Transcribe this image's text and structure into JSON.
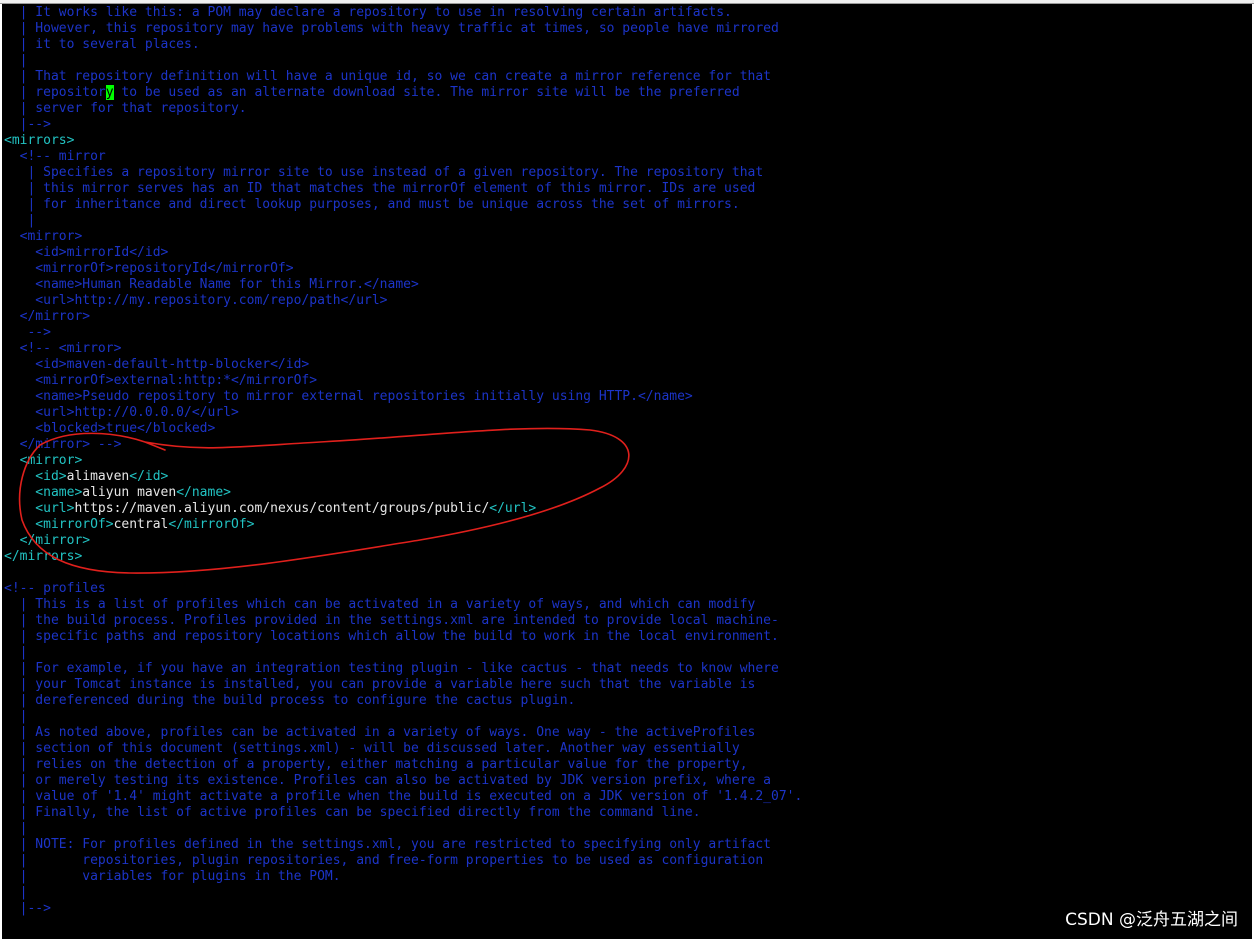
{
  "editor": {
    "lines": [
      {
        "segments": [
          {
            "t": "  | It works like this: a POM may declare a repository to use in resolving certain artifacts.",
            "c": "comment"
          }
        ]
      },
      {
        "segments": [
          {
            "t": "  | However, this repository may have problems with heavy traffic at times, so people have mirrored",
            "c": "comment"
          }
        ]
      },
      {
        "segments": [
          {
            "t": "  | it to several places.",
            "c": "comment"
          }
        ]
      },
      {
        "segments": [
          {
            "t": "  |",
            "c": "comment"
          }
        ]
      },
      {
        "segments": [
          {
            "t": "  | That repository definition will have a unique id, so we can create a mirror reference for that",
            "c": "comment"
          }
        ]
      },
      {
        "segments": [
          {
            "t": "  | repositor",
            "c": "comment"
          },
          {
            "t": "y",
            "c": "cursor"
          },
          {
            "t": " to be used as an alternate download site. The mirror site will be the preferred",
            "c": "comment"
          }
        ]
      },
      {
        "segments": [
          {
            "t": "  | server for that repository.",
            "c": "comment"
          }
        ]
      },
      {
        "segments": [
          {
            "t": "  |-->",
            "c": "comment"
          }
        ]
      },
      {
        "segments": [
          {
            "t": "<mirrors>",
            "c": "tag"
          }
        ]
      },
      {
        "segments": [
          {
            "t": "  <!-- mirror",
            "c": "comment"
          }
        ]
      },
      {
        "segments": [
          {
            "t": "   | Specifies a repository mirror site to use instead of a given repository. The repository that",
            "c": "comment"
          }
        ]
      },
      {
        "segments": [
          {
            "t": "   | this mirror serves has an ID that matches the mirrorOf element of this mirror. IDs are used",
            "c": "comment"
          }
        ]
      },
      {
        "segments": [
          {
            "t": "   | for inheritance and direct lookup purposes, and must be unique across the set of mirrors.",
            "c": "comment"
          }
        ]
      },
      {
        "segments": [
          {
            "t": "   |",
            "c": "comment"
          }
        ]
      },
      {
        "segments": [
          {
            "t": "  <mirror>",
            "c": "comment"
          }
        ]
      },
      {
        "segments": [
          {
            "t": "    <id>mirrorId</id>",
            "c": "comment"
          }
        ]
      },
      {
        "segments": [
          {
            "t": "    <mirrorOf>repositoryId</mirrorOf>",
            "c": "comment"
          }
        ]
      },
      {
        "segments": [
          {
            "t": "    <name>Human Readable Name for this Mirror.</name>",
            "c": "comment"
          }
        ]
      },
      {
        "segments": [
          {
            "t": "    <url>http://my.repository.com/repo/path</url>",
            "c": "comment"
          }
        ]
      },
      {
        "segments": [
          {
            "t": "  </mirror>",
            "c": "comment"
          }
        ]
      },
      {
        "segments": [
          {
            "t": "   -->",
            "c": "comment"
          }
        ]
      },
      {
        "segments": [
          {
            "t": "  <!-- <mirror>",
            "c": "comment"
          }
        ]
      },
      {
        "segments": [
          {
            "t": "    <id>maven-default-http-blocker</id>",
            "c": "comment"
          }
        ]
      },
      {
        "segments": [
          {
            "t": "    <mirrorOf>external:http:*</mirrorOf>",
            "c": "comment"
          }
        ]
      },
      {
        "segments": [
          {
            "t": "    <name>Pseudo repository to mirror external repositories initially using HTTP.</name>",
            "c": "comment"
          }
        ]
      },
      {
        "segments": [
          {
            "t": "    <url>http://0.0.0.0/</url>",
            "c": "comment"
          }
        ]
      },
      {
        "segments": [
          {
            "t": "    <blocked>true</blocked>",
            "c": "comment"
          }
        ]
      },
      {
        "segments": [
          {
            "t": "  </mirror> -->",
            "c": "comment"
          }
        ]
      },
      {
        "segments": [
          {
            "t": "  <mirror>",
            "c": "tag"
          }
        ]
      },
      {
        "segments": [
          {
            "t": "    <id>",
            "c": "tag"
          },
          {
            "t": "alimaven",
            "c": "text"
          },
          {
            "t": "</id>",
            "c": "tag"
          }
        ]
      },
      {
        "segments": [
          {
            "t": "    <name>",
            "c": "tag"
          },
          {
            "t": "aliyun maven",
            "c": "text"
          },
          {
            "t": "</name>",
            "c": "tag"
          }
        ]
      },
      {
        "segments": [
          {
            "t": "    <url>",
            "c": "tag"
          },
          {
            "t": "https://maven.aliyun.com/nexus/content/groups/public/",
            "c": "text"
          },
          {
            "t": "</url>",
            "c": "tag"
          }
        ]
      },
      {
        "segments": [
          {
            "t": "    <mirrorOf>",
            "c": "tag"
          },
          {
            "t": "central",
            "c": "text"
          },
          {
            "t": "</mirrorOf>",
            "c": "tag"
          }
        ]
      },
      {
        "segments": [
          {
            "t": "  </mirror>",
            "c": "tag"
          }
        ]
      },
      {
        "segments": [
          {
            "t": "</mirrors>",
            "c": "tag"
          }
        ]
      },
      {
        "segments": [
          {
            "t": "",
            "c": "text"
          }
        ]
      },
      {
        "segments": [
          {
            "t": "<!-- profiles",
            "c": "comment"
          }
        ]
      },
      {
        "segments": [
          {
            "t": "  | This is a list of profiles which can be activated in a variety of ways, and which can modify",
            "c": "comment"
          }
        ]
      },
      {
        "segments": [
          {
            "t": "  | the build process. Profiles provided in the settings.xml are intended to provide local machine-",
            "c": "comment"
          }
        ]
      },
      {
        "segments": [
          {
            "t": "  | specific paths and repository locations which allow the build to work in the local environment.",
            "c": "comment"
          }
        ]
      },
      {
        "segments": [
          {
            "t": "  |",
            "c": "comment"
          }
        ]
      },
      {
        "segments": [
          {
            "t": "  | For example, if you have an integration testing plugin - like cactus - that needs to know where",
            "c": "comment"
          }
        ]
      },
      {
        "segments": [
          {
            "t": "  | your Tomcat instance is installed, you can provide a variable here such that the variable is",
            "c": "comment"
          }
        ]
      },
      {
        "segments": [
          {
            "t": "  | dereferenced during the build process to configure the cactus plugin.",
            "c": "comment"
          }
        ]
      },
      {
        "segments": [
          {
            "t": "  |",
            "c": "comment"
          }
        ]
      },
      {
        "segments": [
          {
            "t": "  | As noted above, profiles can be activated in a variety of ways. One way - the activeProfiles",
            "c": "comment"
          }
        ]
      },
      {
        "segments": [
          {
            "t": "  | section of this document (settings.xml) - will be discussed later. Another way essentially",
            "c": "comment"
          }
        ]
      },
      {
        "segments": [
          {
            "t": "  | relies on the detection of a property, either matching a particular value for the property,",
            "c": "comment"
          }
        ]
      },
      {
        "segments": [
          {
            "t": "  | or merely testing its existence. Profiles can also be activated by JDK version prefix, where a",
            "c": "comment"
          }
        ]
      },
      {
        "segments": [
          {
            "t": "  | value of '1.4' might activate a profile when the build is executed on a JDK version of '1.4.2_07'.",
            "c": "comment"
          }
        ]
      },
      {
        "segments": [
          {
            "t": "  | Finally, the list of active profiles can be specified directly from the command line.",
            "c": "comment"
          }
        ]
      },
      {
        "segments": [
          {
            "t": "  |",
            "c": "comment"
          }
        ]
      },
      {
        "segments": [
          {
            "t": "  | NOTE: For profiles defined in the settings.xml, you are restricted to specifying only artifact",
            "c": "comment"
          }
        ]
      },
      {
        "segments": [
          {
            "t": "  |       repositories, plugin repositories, and free-form properties to be used as configuration",
            "c": "comment"
          }
        ]
      },
      {
        "segments": [
          {
            "t": "  |       variables for plugins in the POM.",
            "c": "comment"
          }
        ]
      },
      {
        "segments": [
          {
            "t": "  |",
            "c": "comment"
          }
        ]
      },
      {
        "segments": [
          {
            "t": "  |-->",
            "c": "comment"
          }
        ]
      }
    ]
  },
  "colors": {
    "background": "#000000",
    "comment": "#1c34c8",
    "tag": "#22c3c3",
    "text": "#e6e6e6",
    "cursor": "#00ff00",
    "annotation": "#e0201c"
  },
  "watermark": "CSDN @泛舟五湖之间"
}
